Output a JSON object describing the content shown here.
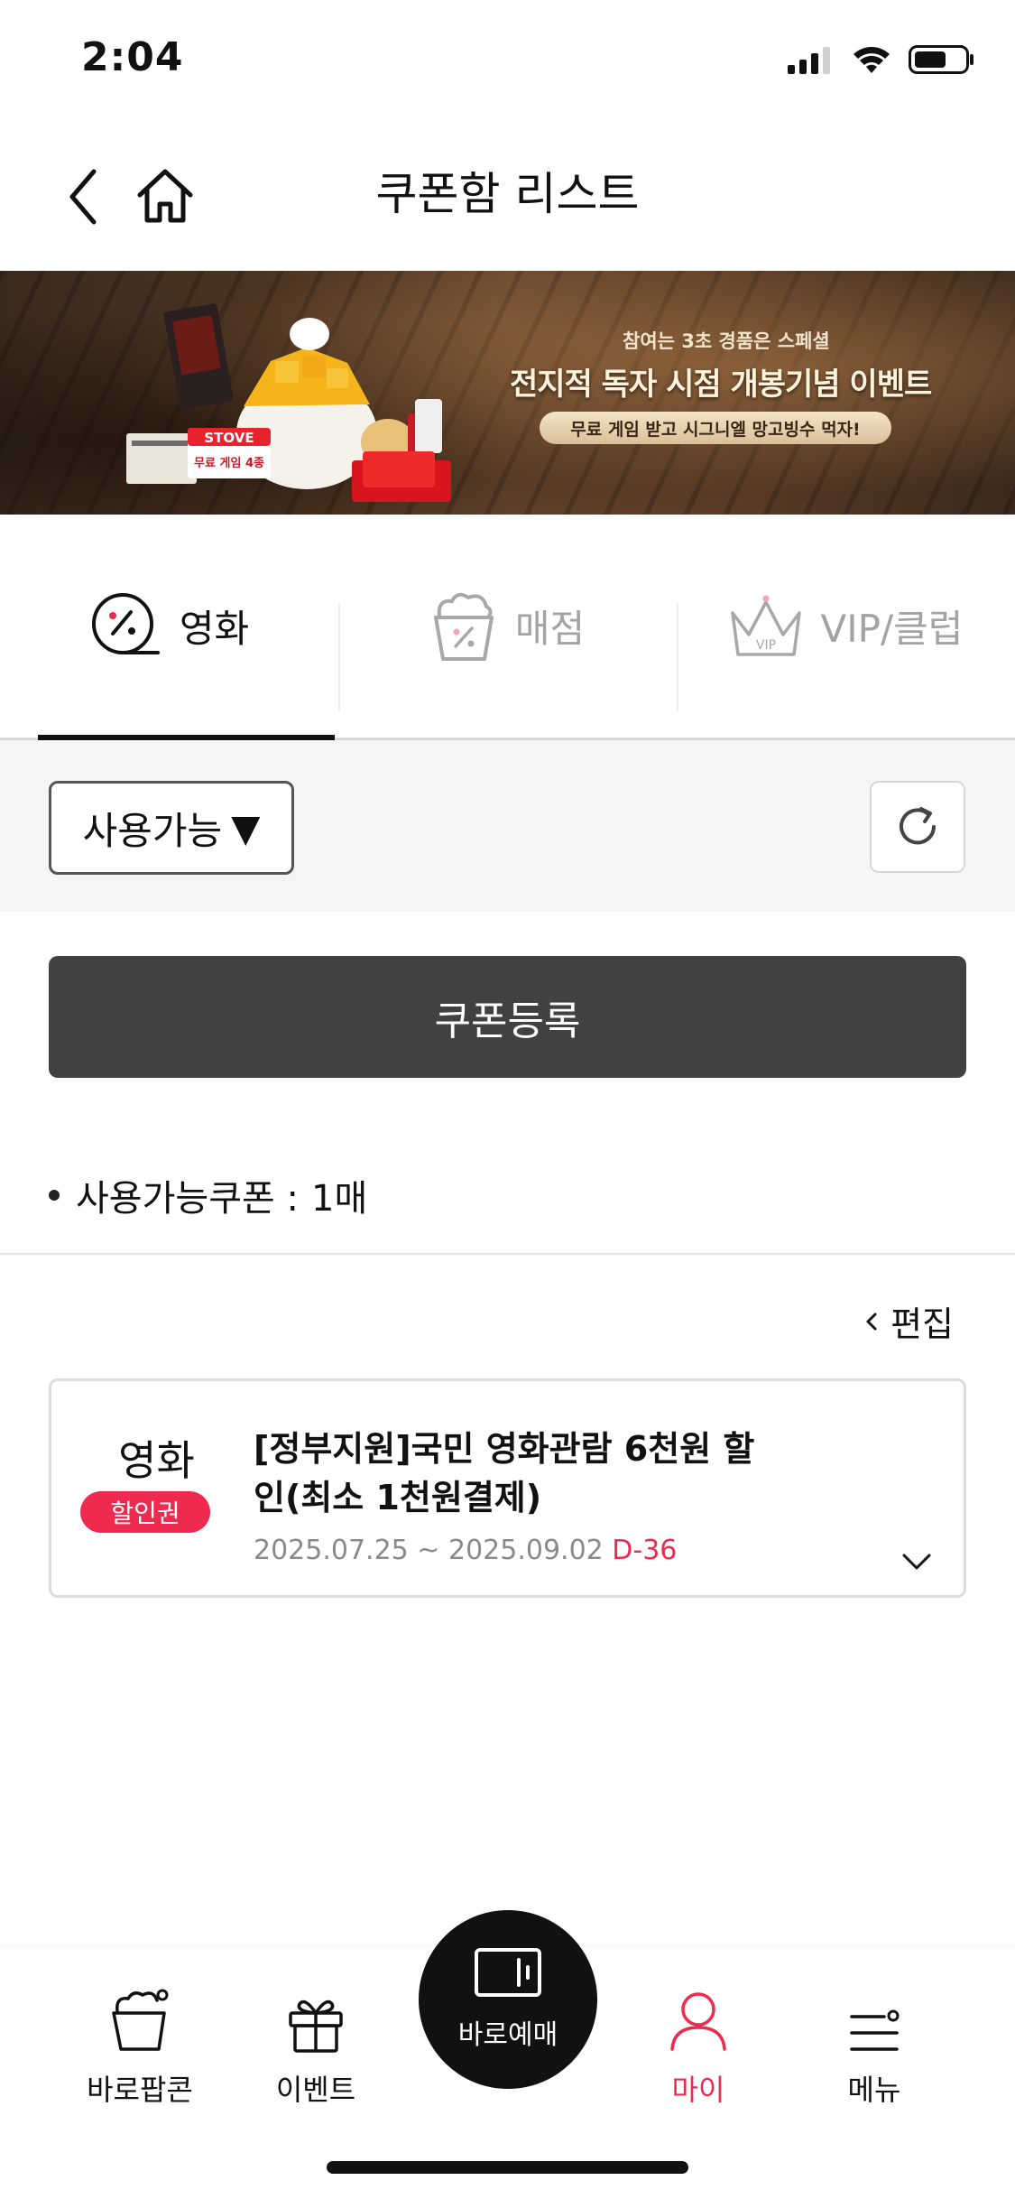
{
  "status_bar": {
    "time": "2:04"
  },
  "header": {
    "title": "쿠폰함 리스트"
  },
  "banner": {
    "subtitle": "참여는 3초 경품은 스페셜",
    "headline": "전지적 독자 시점 개봉기념 이벤트",
    "pill": "무료 게임 받고 시그니엘 망고빙수 먹자!",
    "stove_brand": "STOVE",
    "stove_label": "무료 게임 4종"
  },
  "category_tabs": [
    {
      "label": "영화",
      "icon": "movie-coupon-icon",
      "active": true
    },
    {
      "label": "매점",
      "icon": "snack-coupon-icon",
      "active": false
    },
    {
      "label": "VIP/클럽",
      "icon": "vip-crown-icon",
      "active": false
    }
  ],
  "filter": {
    "selected": "사용가능",
    "arrow": "▼"
  },
  "register_button": "쿠폰등록",
  "coupon_count": {
    "label": "사용가능쿠폰 :",
    "value": "1매"
  },
  "edit": {
    "label": "편집"
  },
  "coupons": [
    {
      "type": "영화",
      "badge": "할인권",
      "title": "[정부지원]국민 영화관람 6천원 할인(최소 1천원결제)",
      "period": "2025.07.25 ~ 2025.09.02",
      "dday": "D-36"
    }
  ],
  "bottom_nav": {
    "popcorn": "바로팝콘",
    "event": "이벤트",
    "booking": "바로예매",
    "my": "마이",
    "menu": "메뉴"
  },
  "colors": {
    "accent": "#ee2a4f",
    "dark_button": "#414141",
    "filter_bg": "#f5f5f5"
  }
}
